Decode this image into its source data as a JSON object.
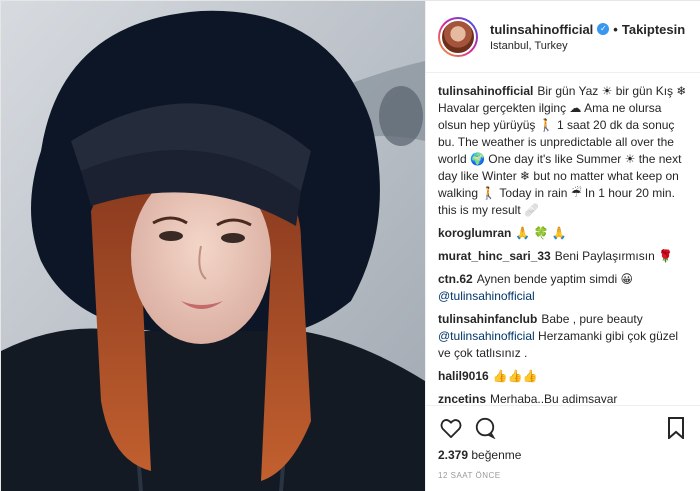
{
  "header": {
    "username": "tulinsahinofficial",
    "verified_glyph": "✓",
    "separator": "•",
    "follow_status": "Takiptesin",
    "location": "Istanbul, Turkey"
  },
  "caption": {
    "user": "tulinsahinofficial",
    "text": "Bir gün Yaz ☀ bir gün Kış ❄ Havalar gerçekten ilginç ☁ Ama ne olursa olsun hep yürüyüş 🚶 1 saat 20 dk da sonuç bu. The weather is unpredictable all over the world 🌍 One day it's like Summer ☀ the next day like Winter ❄ but no matter what keep on walking 🚶 Today in rain ☔ In 1 hour 20 min. this is my result 🩹"
  },
  "comments": [
    {
      "user": "koroglumran",
      "text": "🙏 🍀 🙏"
    },
    {
      "user": "murat_hinc_sari_33",
      "text": "Beni Paylaşırmısın 🌹"
    },
    {
      "user": "ctn.62",
      "text": "Aynen bende yaptim simdi 😀",
      "mention": "@tulinsahinofficial"
    },
    {
      "user": "tulinsahinfanclub",
      "text": "Babe , pure beauty",
      "mention": "@tulinsahinofficial",
      "text2": "Herzamanki gibi çok güzel ve çok tatlısınız ."
    },
    {
      "user": "halil9016",
      "text": "👍👍👍"
    },
    {
      "user": "zncetins",
      "text": "Merhaba..Bu adimsayar"
    }
  ],
  "actions": {
    "like_icon": "heart-icon",
    "comment_icon": "comment-bubble-icon",
    "save_icon": "bookmark-icon"
  },
  "likes": {
    "count": "2.379",
    "label": "beğenme"
  },
  "timestamp": "12 SAAT ÖNCE",
  "colors": {
    "verified": "#3897f0",
    "mention": "#003569",
    "hood_fur": "#0d1626"
  }
}
